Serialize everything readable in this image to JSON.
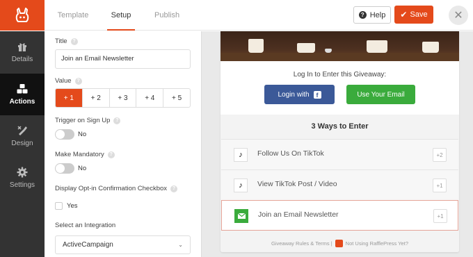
{
  "app": {
    "brand_color": "#e44a1b",
    "logo_icon": "rabbit-icon"
  },
  "header": {
    "tabs": [
      {
        "label": "Template",
        "active": false
      },
      {
        "label": "Setup",
        "active": true
      },
      {
        "label": "Publish",
        "active": false
      }
    ],
    "help_label": "Help",
    "save_label": "Save",
    "close_icon": "close-icon"
  },
  "sidebar": {
    "items": [
      {
        "label": "Details",
        "icon": "gift-icon",
        "active": false
      },
      {
        "label": "Actions",
        "icon": "cubes-icon",
        "active": true
      },
      {
        "label": "Design",
        "icon": "brush-icon",
        "active": false
      },
      {
        "label": "Settings",
        "icon": "gear-icon",
        "active": false
      }
    ]
  },
  "settings": {
    "title_label": "Title",
    "title_value": "Join an Email Newsletter",
    "value_label": "Value",
    "value_options": [
      "+ 1",
      "+ 2",
      "+ 3",
      "+ 4",
      "+ 5"
    ],
    "value_selected": "+ 1",
    "trigger_label": "Trigger on Sign Up",
    "trigger_state": "No",
    "mandatory_label": "Make Mandatory",
    "mandatory_state": "No",
    "optin_label": "Display Opt-in Confirmation Checkbox",
    "optin_checkbox_label": "Yes",
    "integration_label": "Select an Integration",
    "integration_value": "ActiveCampaign"
  },
  "preview": {
    "login_text": "Log In to Enter this Giveaway:",
    "facebook_button": "Login with",
    "email_button": "Use Your Email",
    "ways_title": "3 Ways to Enter",
    "entries": [
      {
        "label": "Follow Us On TikTok",
        "points": "+2",
        "icon": "tiktok-icon"
      },
      {
        "label": "View TikTok Post / Video",
        "points": "+1",
        "icon": "tiktok-icon"
      },
      {
        "label": "Join an Email Newsletter",
        "points": "+1",
        "icon": "email-icon",
        "selected": true
      }
    ],
    "footer_rules": "Giveaway Rules & Terms |",
    "footer_promo": "Not Using RafflePress Yet?",
    "facebook_color": "#3b5998",
    "email_color": "#3aab3c"
  }
}
